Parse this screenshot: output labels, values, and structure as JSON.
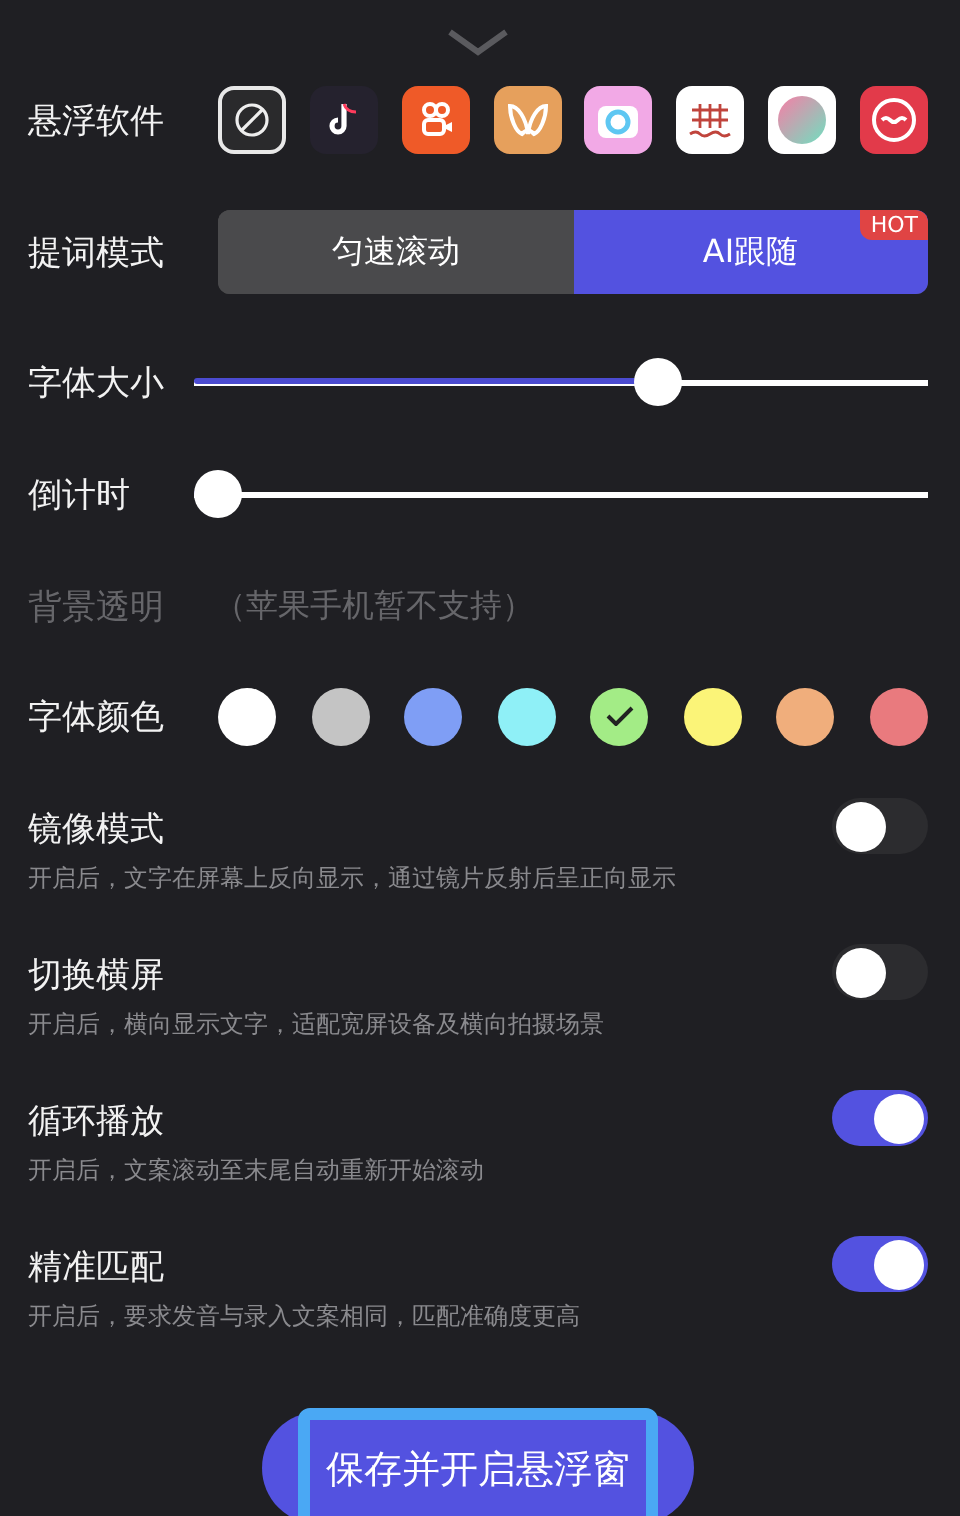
{
  "float_apps": {
    "label": "悬浮软件",
    "apps": [
      {
        "kind": "none",
        "color": "#2a2a2c",
        "selected": true
      },
      {
        "kind": "note",
        "color": "#25222e",
        "selected": false
      },
      {
        "kind": "camera",
        "color": "#ef5a28",
        "selected": false
      },
      {
        "kind": "butterfly",
        "color": "#e6a05c",
        "selected": false
      },
      {
        "kind": "ring",
        "color": "#f2a9e6",
        "selected": false
      },
      {
        "kind": "grid",
        "color": "#ffffff",
        "selected": false
      },
      {
        "kind": "gradient",
        "color": "#ffffff",
        "selected": false
      },
      {
        "kind": "face",
        "color": "#e23a4a",
        "selected": false
      }
    ]
  },
  "prompt_mode": {
    "label": "提词模式",
    "options": [
      {
        "label": "匀速滚动",
        "selected": false
      },
      {
        "label": "AI跟随",
        "selected": true,
        "badge": "HOT"
      }
    ]
  },
  "sliders": [
    {
      "label": "字体大小",
      "level": 0.64
    },
    {
      "label": "倒计时",
      "level": 0
    }
  ],
  "background": {
    "label": "背景透明",
    "note": "（苹果手机暂不支持）",
    "disabled": true
  },
  "font_color": {
    "label": "字体颜色",
    "colors": [
      {
        "color": "#ffffff",
        "selected": false
      },
      {
        "color": "#c4c4c4",
        "selected": false
      },
      {
        "color": "#7f9ef5",
        "selected": false
      },
      {
        "color": "#8ff0f7",
        "selected": false
      },
      {
        "color": "#a3ec86",
        "selected": true
      },
      {
        "color": "#fbf478",
        "selected": false
      },
      {
        "color": "#f0ae7c",
        "selected": false
      },
      {
        "color": "#e97a7e",
        "selected": false
      }
    ]
  },
  "toggles": [
    {
      "title": "镜像模式",
      "description": "开启后，文字在屏幕上反向显示，通过镜片反射后呈正向显示",
      "on": false
    },
    {
      "title": "切换横屏",
      "description": "开启后，横向显示文字，适配宽屏设备及横向拍摄场景",
      "on": false
    },
    {
      "title": "循环播放",
      "description": "开启后，文案滚动至末尾自动重新开始滚动",
      "on": true
    },
    {
      "title": "精准匹配",
      "description": "开启后，要求发音与录入文案相同，匹配准确度更高",
      "on": true
    }
  ],
  "save_button": {
    "label": "保存并开启悬浮窗",
    "highlighted": true
  }
}
